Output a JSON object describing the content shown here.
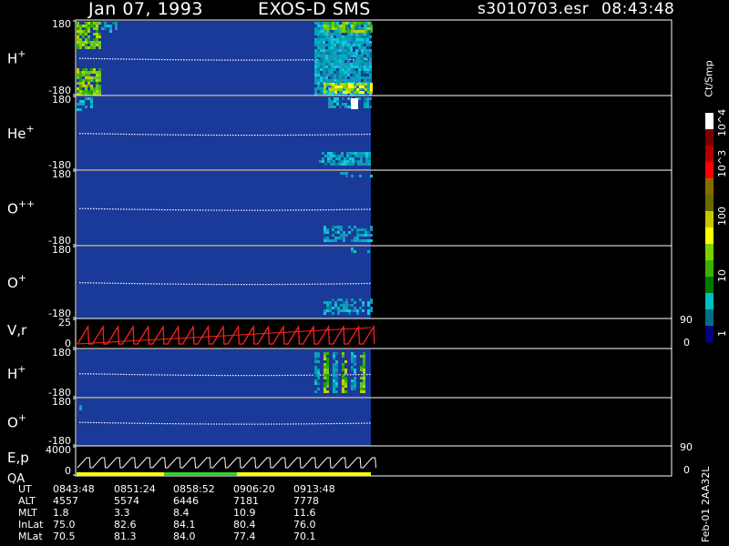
{
  "header": {
    "date": "Jan 07, 1993",
    "instrument": "EXOS-D SMS",
    "file": "s3010703.esr",
    "time": "08:43:48"
  },
  "colorbar": {
    "units": "Ct/Smp",
    "tick_labels": [
      "10^4",
      "10^3",
      "100",
      "10",
      "1"
    ],
    "colors": [
      "#ffffff",
      "#7a0000",
      "#b00000",
      "#ff0000",
      "#8a6a00",
      "#6a6a00",
      "#c8c800",
      "#ffff00",
      "#7ad000",
      "#40b000",
      "#007800",
      "#00c0c0",
      "#007080",
      "#000080"
    ]
  },
  "chart_data": [
    {
      "type": "heatmap",
      "label": "H+",
      "yticks": [
        "180",
        "-180"
      ],
      "x_range": [
        "0843:48",
        "0913:48"
      ],
      "data_end": "0913:48"
    },
    {
      "type": "heatmap",
      "label": "He+",
      "yticks": [
        "180",
        "-180"
      ]
    },
    {
      "type": "heatmap",
      "label": "O++",
      "yticks": [
        "180",
        "-180"
      ]
    },
    {
      "type": "heatmap",
      "label": "O+",
      "yticks": [
        "180",
        "-180"
      ]
    },
    {
      "type": "line",
      "label": "V,r",
      "left_ticks": [
        "25",
        "0"
      ],
      "right_ticks": [
        "90",
        "0"
      ],
      "series": [
        {
          "color": "#ff2020",
          "pattern": "sawtooth"
        }
      ]
    },
    {
      "type": "heatmap",
      "label": "H+",
      "yticks": [
        "180",
        "-180"
      ]
    },
    {
      "type": "heatmap",
      "label": "O+",
      "yticks": [
        "180",
        "-180"
      ]
    },
    {
      "type": "line",
      "label": "E,p",
      "sublabel": "QA",
      "left_ticks": [
        "4000",
        "0"
      ],
      "right_ticks": [
        "90",
        "0"
      ],
      "series": [
        {
          "color": "#ffffff",
          "pattern": "sawtooth"
        }
      ],
      "qa_bar_colors": [
        "#ffff00",
        "#30d030"
      ]
    }
  ],
  "ephemeris": {
    "rows": [
      {
        "name": "UT",
        "values": [
          "0843:48",
          "0851:24",
          "0858:52",
          "0906:20",
          "0913:48"
        ]
      },
      {
        "name": "ALT",
        "values": [
          "4557",
          "5574",
          "6446",
          "7181",
          "7778"
        ]
      },
      {
        "name": "MLT",
        "values": [
          "1.8",
          "3.3",
          "8.4",
          "10.9",
          "11.6"
        ]
      },
      {
        "name": "InLat",
        "values": [
          "75.0",
          "82.6",
          "84.1",
          "80.4",
          "76.0"
        ]
      },
      {
        "name": "MLat",
        "values": [
          "70.5",
          "81.3",
          "84.0",
          "77.4",
          "70.1"
        ]
      }
    ]
  },
  "footer_code": "Feb-01 2AA32L"
}
